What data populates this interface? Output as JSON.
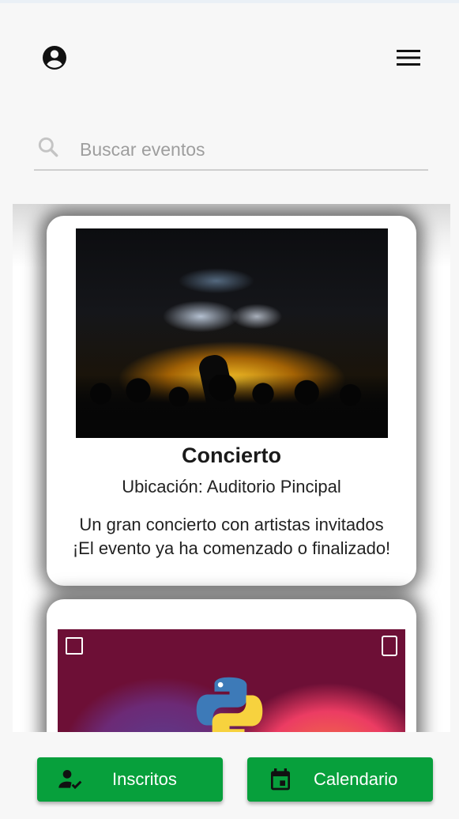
{
  "header": {
    "account_icon": "account-circle-icon",
    "menu_icon": "hamburger-menu-icon"
  },
  "search": {
    "placeholder": "Buscar eventos",
    "value": "",
    "icon": "search-icon"
  },
  "events": [
    {
      "title": "Concierto",
      "location": "Ubicación: Auditorio Pincipal",
      "description": "Un gran concierto con artistas invitados",
      "status": "¡El evento ya ha comenzado o finalizado!",
      "image": "concert-photo"
    },
    {
      "image": "python-event-banner"
    }
  ],
  "bottom_nav": {
    "inscritos_label": "Inscritos",
    "inscritos_icon": "person-check-icon",
    "calendario_label": "Calendario",
    "calendario_icon": "calendar-icon"
  },
  "colors": {
    "accent_green": "#07a03c",
    "background": "#f7f7f7"
  }
}
